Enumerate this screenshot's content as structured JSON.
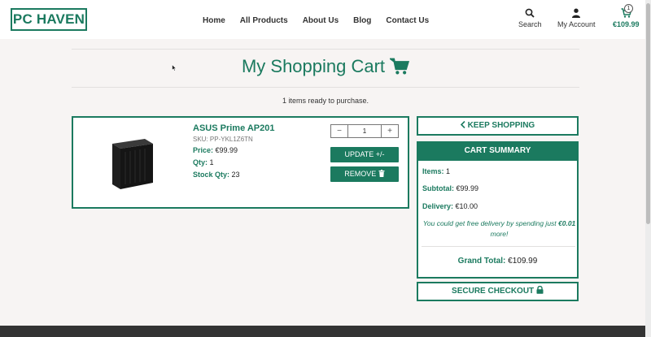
{
  "brand": {
    "logo_text": "PC HAVEN",
    "accent_color": "#1b7a5f"
  },
  "nav": {
    "links": [
      "Home",
      "All Products",
      "About Us",
      "Blog",
      "Contact Us"
    ],
    "search_label": "Search",
    "account_label": "My Account",
    "cart_total": "€109.99",
    "cart_count": "1",
    "icons": {
      "search": "search-icon",
      "account": "user-icon",
      "cart": "cart-icon"
    }
  },
  "page": {
    "title": "My Shopping Cart",
    "subtitle": "1 items ready to purchase."
  },
  "cart_item": {
    "name": "ASUS Prime AP201",
    "sku": "SKU: PP-YKL1Z6TN",
    "price_label": "Price:",
    "price_value": " €99.99",
    "qty_label": "Qty:",
    "qty_value": " 1",
    "stock_label": "Stock Qty:",
    "stock_value": " 23",
    "quantity_input": "1",
    "minus": "−",
    "plus": "+",
    "update_label": "UPDATE +/-",
    "remove_label": "REMOVE"
  },
  "summary": {
    "keep_shopping": "KEEP SHOPPING",
    "header": "CART SUMMARY",
    "items_label": "Items:",
    "items_value": " 1",
    "subtotal_label": "Subtotal:",
    "subtotal_value": " €99.99",
    "delivery_label": "Delivery:",
    "delivery_value": " €10.00",
    "free_delivery_text": "You could get free delivery by spending just ",
    "free_delivery_amount": "€0.01",
    "free_delivery_suffix": " more!",
    "grand_total_label": "Grand Total:",
    "grand_total_value": " €109.99",
    "checkout_label": "SECURE CHECKOUT"
  }
}
